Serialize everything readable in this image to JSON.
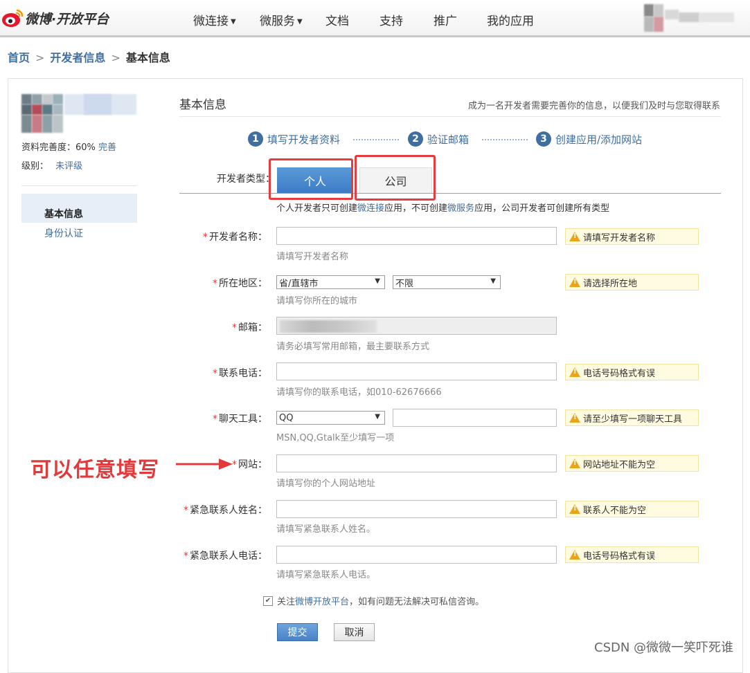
{
  "header": {
    "logo_text": "微博·开放平台",
    "nav": [
      "微连接",
      "微服务",
      "文档",
      "支持",
      "推广",
      "我的应用"
    ]
  },
  "breadcrumb": [
    "首页",
    "开发者信息",
    "基本信息"
  ],
  "sidebar": {
    "profile_completeness_label": "资料完善度：60%",
    "profile_complete_link": "完善",
    "level_label": "级别：",
    "level_value": "未评级",
    "menu": [
      "基本信息",
      "身份认证"
    ]
  },
  "main": {
    "title": "基本信息",
    "tip": "成为一名开发者需要完善你的信息，以便我们及时与您取得联系",
    "steps": [
      {
        "num": "1",
        "label": "填写开发者资料"
      },
      {
        "num": "2",
        "label": "验证邮箱"
      },
      {
        "num": "3",
        "label": "创建应用/添加网站"
      }
    ],
    "developer_type_label": "开发者类型：",
    "type_tabs": [
      "个人",
      "公司"
    ],
    "type_note": {
      "p1": "个人开发者只可创建",
      "l1": "微连接",
      "p2": "应用，不可创建",
      "l2": "微服务",
      "p3": "应用，公司开发者可创建所有类型"
    },
    "fields": {
      "name": {
        "label": "开发者名称：",
        "hint": "请填写开发者名称",
        "warning": "请填写开发者名称"
      },
      "region": {
        "label": "所在地区：",
        "province": "省/直辖市",
        "city": "不限",
        "hint": "请填写你所在的城市",
        "warning": "请选择所在地"
      },
      "email": {
        "label": "邮箱：",
        "hint": "请务必填写常用邮箱，最主要联系方式"
      },
      "phone": {
        "label": "联系电话：",
        "hint": "请填写你的联系电话，如010-62676666",
        "warning": "电话号码格式有误"
      },
      "chat": {
        "label": "聊天工具：",
        "tool": "QQ",
        "hint": "MSN,QQ,Gtalk至少填写一项",
        "warning": "请至少填写一项聊天工具"
      },
      "website": {
        "label": "网站：",
        "hint": "请填写你的个人网站地址",
        "warning": "网站地址不能为空"
      },
      "emergency_name": {
        "label": "紧急联系人姓名：",
        "hint": "请填写紧急联系人姓名。",
        "warning": "联系人不能为空"
      },
      "emergency_phone": {
        "label": "紧急联系人电话：",
        "hint": "请填写紧急联系人电话。",
        "warning": "电话号码格式有误"
      }
    },
    "follow": {
      "p1": "关注",
      "link": "微博开放平台",
      "p2": "，如有问题无法解决可私信咨询。"
    },
    "submit": "提交",
    "cancel": "取消"
  },
  "annotation": "可以任意填写",
  "watermark": "CSDN @微微一笑吓死谁",
  "colors": {
    "link": "#3f6ea1",
    "tab_active": "#4a88cf",
    "warning_bg": "#fffbe0",
    "annotation": "#e23a3a"
  }
}
